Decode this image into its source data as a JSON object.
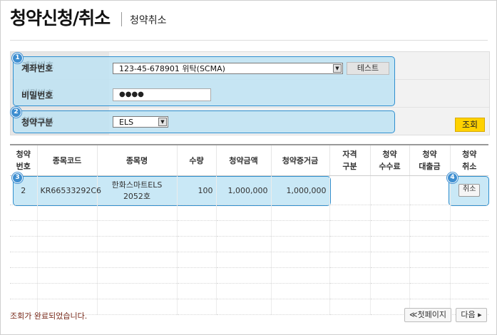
{
  "header": {
    "title": "청약신청/취소",
    "subtitle": "청약취소"
  },
  "form": {
    "account_label": "계좌번호",
    "account_value": "123-45-678901 위탁(SCMA)",
    "test_button": "테스트",
    "password_label": "비밀번호",
    "password_value": "●●●●",
    "category_label": "청약구분",
    "category_value": "ELS",
    "search_button": "조회"
  },
  "badges": [
    "1",
    "2",
    "3",
    "4"
  ],
  "table": {
    "headers": [
      [
        "청약",
        "번호"
      ],
      [
        "종목코드",
        ""
      ],
      [
        "종목명",
        ""
      ],
      [
        "수량",
        ""
      ],
      [
        "청약금액",
        ""
      ],
      [
        "청약증거금",
        ""
      ],
      [
        "자격",
        "구분"
      ],
      [
        "청약",
        "수수료"
      ],
      [
        "청약",
        "대출금"
      ],
      [
        "청약",
        "취소"
      ]
    ],
    "rows": [
      {
        "no": "2",
        "code": "KR66533292C6",
        "name1": "한화스마트ELS",
        "name2": "2052호",
        "qty": "100",
        "amount": "1,000,000",
        "deposit": "1,000,000",
        "qual": "",
        "fee": "",
        "loan": "",
        "cancel": "취소"
      }
    ],
    "empty_rows": 7
  },
  "footer": {
    "status": "조회가 완료되었습니다.",
    "first_page": "≪첫페이지",
    "next": "다음 ▸"
  }
}
